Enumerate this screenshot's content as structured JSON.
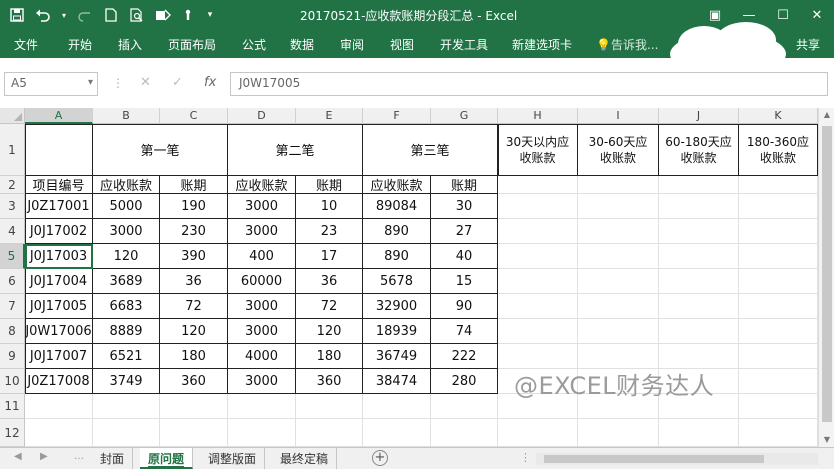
{
  "window": {
    "title": "20170521-应收款账期分段汇总 - Excel"
  },
  "qat_icons": [
    "save-icon",
    "undo-icon",
    "redo-icon",
    "new-file-icon",
    "print-preview-icon",
    "touch-mode-icon",
    "redo-more-icon",
    "customize-icon"
  ],
  "window_controls": {
    "restore_ribbon": "▣",
    "minimize": "—",
    "maximize": "☐",
    "close": "✕"
  },
  "ribbon": {
    "tabs": [
      "文件",
      "开始",
      "插入",
      "页面布局",
      "公式",
      "数据",
      "审阅",
      "视图",
      "开发工具",
      "新建选项卡"
    ],
    "tell_me": "告诉我...",
    "share": "共享"
  },
  "formula_bar": {
    "name_box": "A5",
    "formula": "J0W17005"
  },
  "columns": [
    "A",
    "B",
    "C",
    "D",
    "E",
    "F",
    "G",
    "H",
    "I",
    "J",
    "K"
  ],
  "rows": [
    "1",
    "2",
    "3",
    "4",
    "5",
    "6",
    "7",
    "8",
    "9",
    "10",
    "11",
    "12"
  ],
  "sheet": {
    "groups": [
      "第一笔",
      "第二笔",
      "第三笔"
    ],
    "aging_headers": [
      [
        "30天以内应",
        "收账款"
      ],
      [
        "30-60天应",
        "收账款"
      ],
      [
        "60-180天应",
        "收账款"
      ],
      [
        "180-360应",
        "收账款"
      ]
    ],
    "subheaders": [
      "项目编号",
      "应收账款",
      "账期",
      "应收账款",
      "账期",
      "应收账款",
      "账期"
    ],
    "data_rows": [
      [
        "J0Z17001",
        "5000",
        "190",
        "3000",
        "10",
        "89084",
        "30"
      ],
      [
        "J0J17002",
        "3000",
        "230",
        "3000",
        "23",
        "890",
        "27"
      ],
      [
        "J0J17003",
        "120",
        "390",
        "400",
        "17",
        "890",
        "40"
      ],
      [
        "J0J17004",
        "3689",
        "36",
        "60000",
        "36",
        "5678",
        "15"
      ],
      [
        "J0J17005",
        "6683",
        "72",
        "3000",
        "72",
        "32900",
        "90"
      ],
      [
        "J0W17006",
        "8889",
        "120",
        "3000",
        "120",
        "18939",
        "74"
      ],
      [
        "J0J17007",
        "6521",
        "180",
        "4000",
        "180",
        "36749",
        "222"
      ],
      [
        "J0Z17008",
        "3749",
        "360",
        "3000",
        "360",
        "38474",
        "280"
      ]
    ]
  },
  "watermark": "@EXCEL财务达人",
  "sheet_tabs": [
    "封面",
    "原问题",
    "调整版面",
    "最终定稿"
  ],
  "active_sheet": "原问题",
  "colors": {
    "excel_green": "#217346"
  }
}
